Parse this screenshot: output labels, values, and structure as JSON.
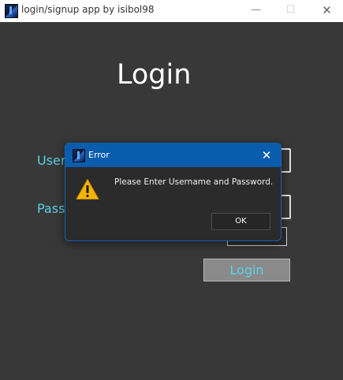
{
  "window": {
    "title": "login/signup app by isibol98",
    "icons": {
      "app": "app-logo-icon",
      "minimize": "minimize-icon",
      "maximize": "maximize-icon",
      "close": "close-icon"
    },
    "glyphs": {
      "minimize": "—",
      "maximize": "☐",
      "close": "✕"
    }
  },
  "form": {
    "heading": "Login",
    "username_label": "Username",
    "password_label": "Password",
    "login_button": "Login"
  },
  "dialog": {
    "title": "Error",
    "message": "Please Enter Username and Password.",
    "ok_button": "OK",
    "close_glyph": "✕",
    "icon": "warning-icon"
  },
  "colors": {
    "background": "#383838",
    "accent_text": "#5ad2e8",
    "dialog_titlebar": "#0a5cad",
    "warning": "#f5b400"
  }
}
